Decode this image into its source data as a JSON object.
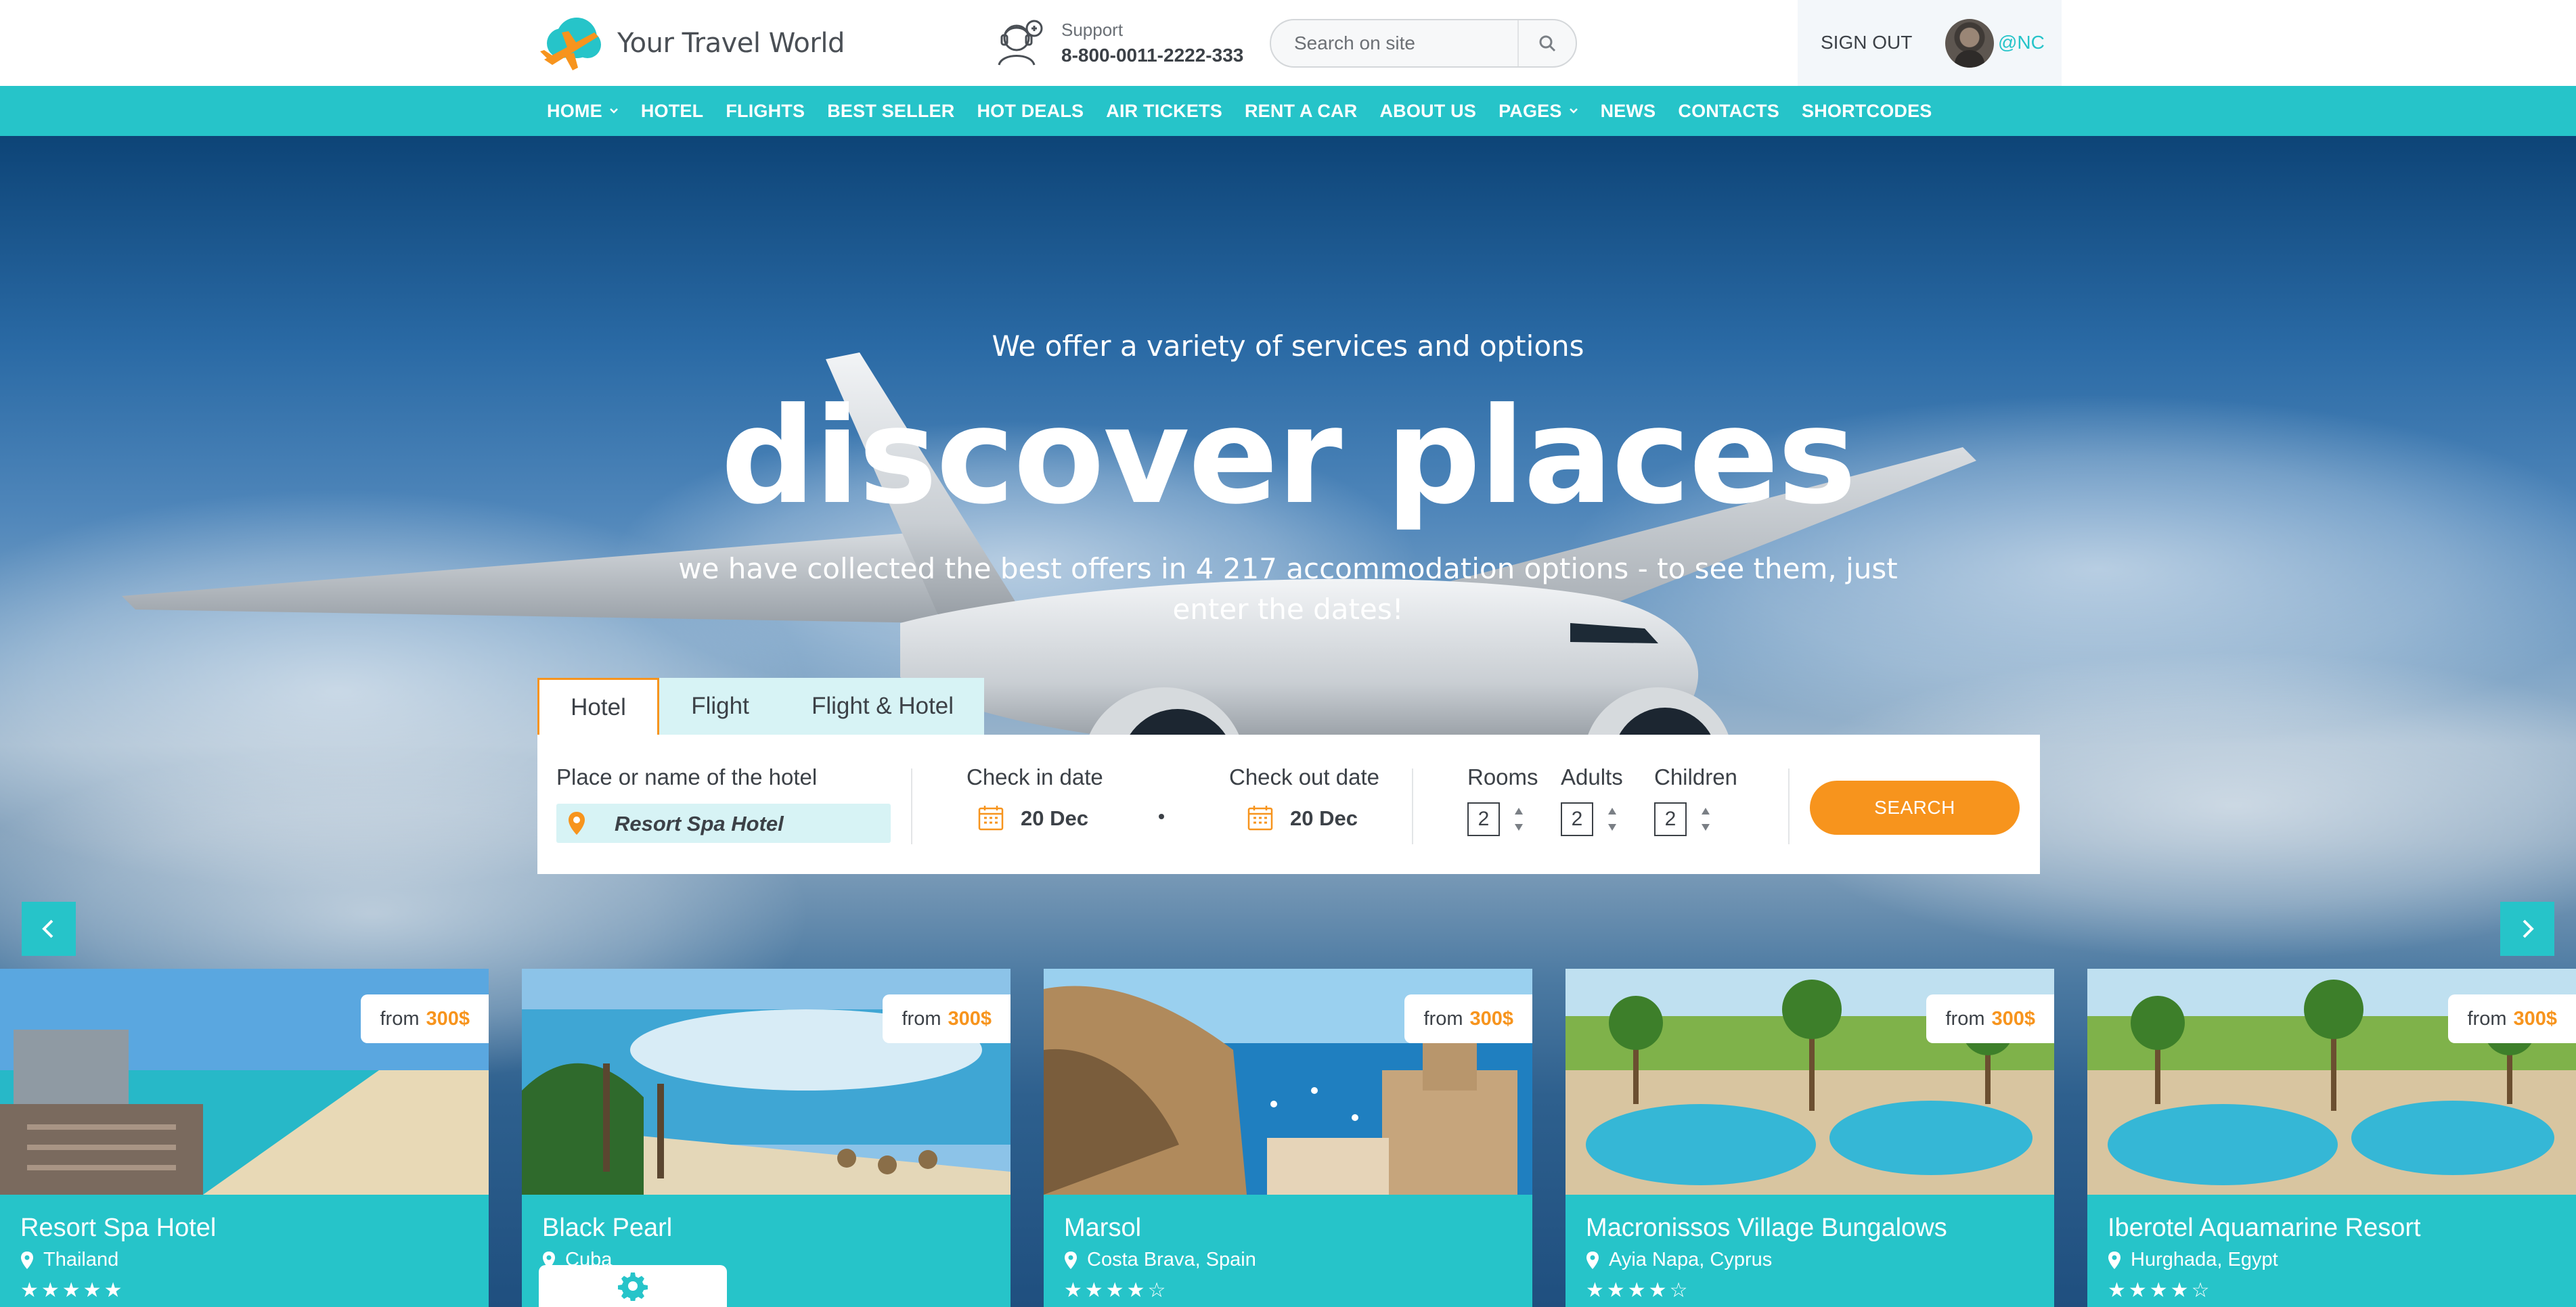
{
  "header": {
    "logo_text": "Your Travel World",
    "support_label": "Support",
    "support_phone": "8-800-0011-2222-333",
    "search_placeholder": "Search on site",
    "sign_out": "SIGN OUT",
    "username": "@NC"
  },
  "nav": {
    "items": [
      {
        "label": "HOME",
        "has_dropdown": true
      },
      {
        "label": "HOTEL"
      },
      {
        "label": "FLIGHTS"
      },
      {
        "label": "BEST SELLER"
      },
      {
        "label": "HOT DEALS"
      },
      {
        "label": "AIR TICKETS"
      },
      {
        "label": "RENT A CAR"
      },
      {
        "label": "ABOUT US"
      },
      {
        "label": "PAGES",
        "has_dropdown": true
      },
      {
        "label": "NEWS"
      },
      {
        "label": "CONTACTS"
      },
      {
        "label": "SHORTCODES"
      }
    ]
  },
  "hero": {
    "kicker": "We offer a variety of services and options",
    "title": "discover places",
    "subtitle": "we have collected the best offers in 4 217 accommodation options - to see them, just enter the dates!"
  },
  "booking": {
    "tabs": [
      "Hotel",
      "Flight",
      "Flight & Hotel"
    ],
    "active_tab": "Hotel",
    "place_label": "Place or name of the hotel",
    "place_value": "Resort Spa Hotel",
    "checkin_label": "Check in date",
    "checkin_value": "20 Dec",
    "checkout_label": "Check out date",
    "checkout_value": "20 Dec",
    "rooms_label": "Rooms",
    "rooms_value": "2",
    "adults_label": "Adults",
    "adults_value": "2",
    "children_label": "Children",
    "children_value": "2",
    "search_label": "SEARCH"
  },
  "cards": [
    {
      "name": "Resort Spa Hotel",
      "location": "Thailand",
      "price_prefix": "from",
      "price": "300$",
      "rating": 5,
      "stars": "★★★★★"
    },
    {
      "name": "Black Pearl",
      "location": "Cuba",
      "price_prefix": "from",
      "price": "300$",
      "rating": 0,
      "stars": ""
    },
    {
      "name": "Marsol",
      "location": "Costa Brava, Spain",
      "price_prefix": "from",
      "price": "300$",
      "rating": 4,
      "stars": "★★★★☆"
    },
    {
      "name": "Macronissos Village Bungalows",
      "location": "Ayia Napa, Cyprus",
      "price_prefix": "from",
      "price": "300$",
      "rating": 4,
      "stars": "★★★★☆"
    },
    {
      "name": "Iberotel Aquamarine Resort",
      "location": "Hurghada, Egypt",
      "price_prefix": "from",
      "price": "300$",
      "rating": 4,
      "stars": "★★★★☆"
    }
  ],
  "icons": {
    "logo": "plane-logo-icon",
    "support": "support-agent-icon",
    "search": "search-icon",
    "place": "map-pin-icon",
    "date": "calendar-icon",
    "prev": "chevron-left-icon",
    "next": "chevron-right-icon",
    "settings": "gear-icon"
  },
  "colors": {
    "accent": "#26c4c9",
    "cta": "#f7941d",
    "text": "#3c4147"
  }
}
